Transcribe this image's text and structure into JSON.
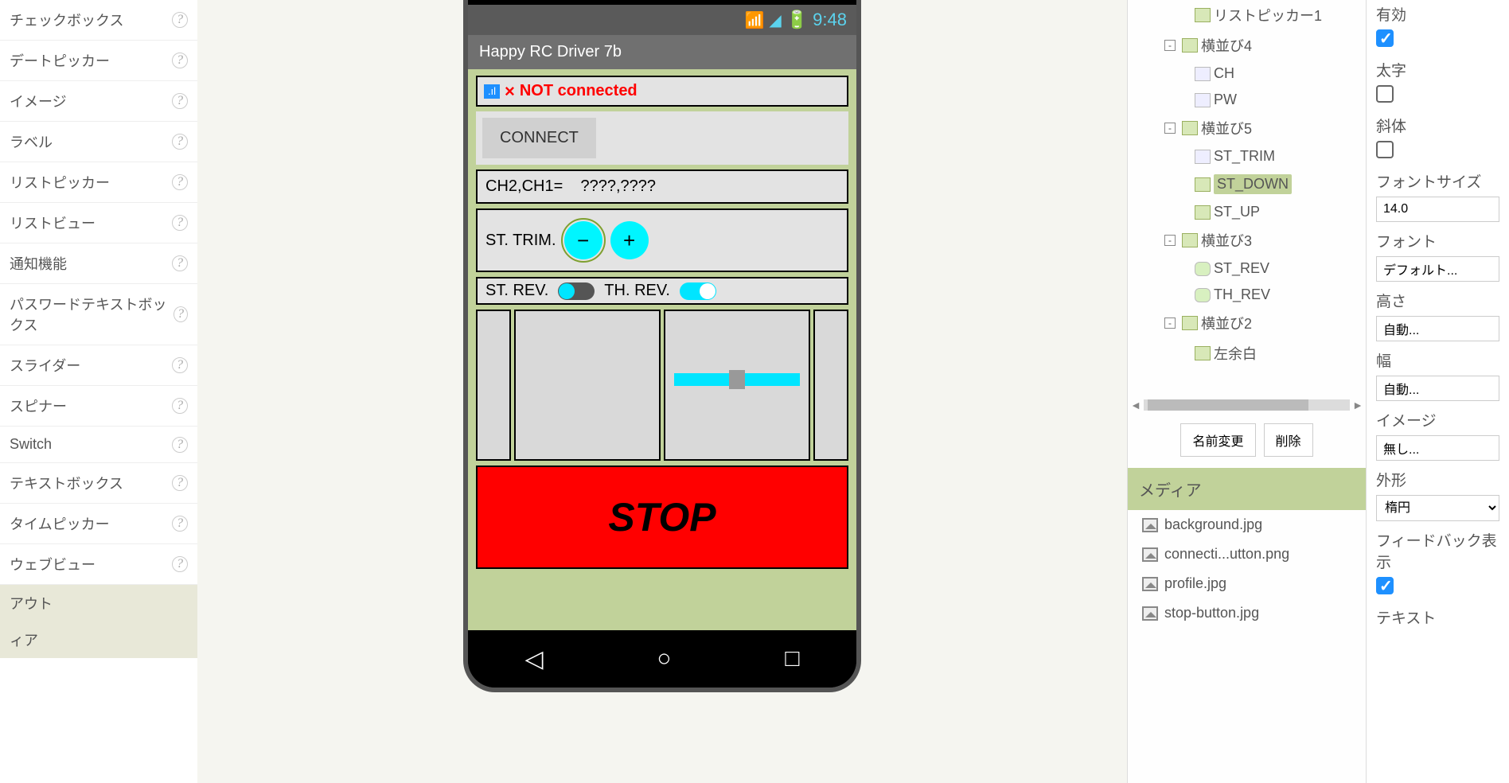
{
  "palette": {
    "items": [
      "チェックボックス",
      "デートピッカー",
      "イメージ",
      "ラベル",
      "リストピッカー",
      "リストビュー",
      "通知機能",
      "パスワードテキストボックス",
      "スライダー",
      "スピナー",
      "Switch",
      "テキストボックス",
      "タイムピッカー",
      "ウェブビュー"
    ],
    "heading1": "アウト",
    "heading2": "ィア"
  },
  "phone": {
    "clock": "9:48",
    "title": "Happy RC Driver 7b",
    "not_connected": "NOT connected",
    "connect": "CONNECT",
    "ch_label": "CH2,CH1=",
    "ch_value": "????,????",
    "st_trim": "ST. TRIM.",
    "minus": "−",
    "plus": "+",
    "st_rev": "ST. REV.",
    "th_rev": "TH. REV.",
    "stop": "STOP"
  },
  "tree": {
    "items": [
      {
        "lv": 2,
        "icon": "hbox",
        "label": "リストピッカー1"
      },
      {
        "lv": 1,
        "expander": "-",
        "icon": "hbox",
        "label": "横並び4"
      },
      {
        "lv": 2,
        "icon": "lbl",
        "label": "CH"
      },
      {
        "lv": 2,
        "icon": "lbl",
        "label": "PW"
      },
      {
        "lv": 1,
        "expander": "-",
        "icon": "hbox",
        "label": "横並び5"
      },
      {
        "lv": 2,
        "icon": "lbl",
        "label": "ST_TRIM"
      },
      {
        "lv": 2,
        "icon": "hbox",
        "label": "ST_DOWN",
        "selected": true
      },
      {
        "lv": 2,
        "icon": "hbox",
        "label": "ST_UP"
      },
      {
        "lv": 1,
        "expander": "-",
        "icon": "hbox",
        "label": "横並び3"
      },
      {
        "lv": 2,
        "icon": "sw",
        "label": "ST_REV"
      },
      {
        "lv": 2,
        "icon": "sw",
        "label": "TH_REV"
      },
      {
        "lv": 1,
        "expander": "-",
        "icon": "hbox",
        "label": "横並び2"
      },
      {
        "lv": 2,
        "icon": "hbox",
        "label": "左余白"
      }
    ],
    "rename": "名前変更",
    "delete": "削除"
  },
  "media": {
    "heading": "メディア",
    "files": [
      "background.jpg",
      "connecti...utton.png",
      "profile.jpg",
      "stop-button.jpg"
    ]
  },
  "props": {
    "enabled_label": "有効",
    "bold_label": "太字",
    "italic_label": "斜体",
    "fontsize_label": "フォントサイズ",
    "fontsize_value": "14.0",
    "font_label": "フォント",
    "font_value": "デフォルト...",
    "height_label": "高さ",
    "height_value": "自動...",
    "width_label": "幅",
    "width_value": "自動...",
    "image_label": "イメージ",
    "image_value": "無し...",
    "shape_label": "外形",
    "shape_value": "楕円",
    "feedback_label": "フィードバック表示",
    "text_label": "テキスト"
  }
}
